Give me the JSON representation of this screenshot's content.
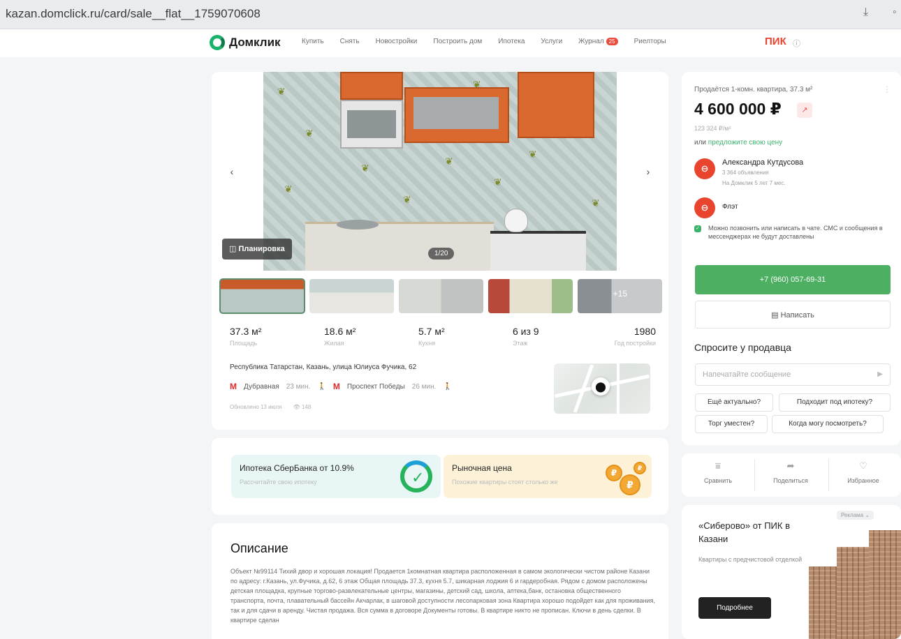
{
  "browser": {
    "url": "kazan.domclick.ru/card/sale__flat__1759070608"
  },
  "header": {
    "logo_text": "Домклик",
    "nav": [
      "Купить",
      "Снять",
      "Новостройки",
      "Построить дом",
      "Ипотека",
      "Услуги",
      "Журнал",
      "Риелторы"
    ],
    "journal_badge": "25",
    "partner": "ПИК"
  },
  "gallery": {
    "plan_label": "Планировка",
    "counter": "1/20",
    "more_thumbs": "+15"
  },
  "stats": [
    {
      "value": "37.3 м²",
      "label": "Площадь"
    },
    {
      "value": "18.6 м²",
      "label": "Жилая"
    },
    {
      "value": "5.7 м²",
      "label": "Кухня"
    },
    {
      "value": "6 из 9",
      "label": "Этаж"
    },
    {
      "value": "1980",
      "label": "Год постройки"
    }
  ],
  "location": {
    "address": "Республика Татарстан, Казань, улица Юлиуса Фучика, 62",
    "metro": [
      {
        "name": "Дубравная",
        "time": "23 мин."
      },
      {
        "name": "Проспект Победы",
        "time": "26 мин."
      }
    ],
    "updated": "Обновлено 13 июля",
    "views": "148"
  },
  "promos": {
    "sber_title": "Ипотека СберБанка от 10.9%",
    "sber_sub": "Рассчитайте свою ипотеку",
    "market_title": "Рыночная цена",
    "market_sub": "Похожие квартиры стоят столько же"
  },
  "description": {
    "title": "Описание",
    "text": "Объект №99114 Тихий двор и хорошая локация! Продается 1комнатная квартира расположенная в самом экологически чистом районе Казани по адресу: г.Казань, ул.Фучика, д.62, 6 этаж Общая площадь 37.3, кухня 5.7, шикарная лоджия 6 и гардеробная. Рядом с домом расположены детская площадка, крупные торгово-развлекательные центры, магазины, детский сад, школа, аптека,банк, остановка общественного транспорта, почта, плавательный бассейн Акчарлак, в шаговой доступности лесопарковая зона Квартира хорошо подойдет как для проживания, так и для сдачи в аренду. Чистая продажа. Вся сумма в договоре Документы готовы. В квартире никто не прописан. Ключи в день сделки. В квартире сделан"
  },
  "sidebar": {
    "listing_title": "Продаётся 1-комн. квартира, 37.3 м²",
    "price": "4 600 000 ₽",
    "price_per_sqm": "123 324 ₽/м²",
    "offer_prefix": "или",
    "offer_link": "предложите свою цену",
    "agent_name": "Александра Кутдусова",
    "agent_listings": "3 364 объявления",
    "agent_since": "На Домклик 5 лет 7 мес.",
    "agency": "Флэт",
    "chat_note": "Можно позвонить или написать в чате. СМС и сообщения в мессенджерах не будут доставлены",
    "phone": "+7 (960) 057-69-31",
    "write": "Написать",
    "ask_title": "Спросите у продавца",
    "ask_placeholder": "Напечатайте сообщение",
    "chips": [
      "Ещё актуально?",
      "Подходит под ипотеку?",
      "Торг уместен?",
      "Когда могу посмотреть?"
    ]
  },
  "actions": [
    "Сравнить",
    "Поделиться",
    "Избранное"
  ],
  "ad": {
    "label": "Реклама",
    "title": "«Сиберово» от ПИК в Казани",
    "sub": "Квартиры с предчистовой отделкой",
    "button": "Подробнее"
  }
}
